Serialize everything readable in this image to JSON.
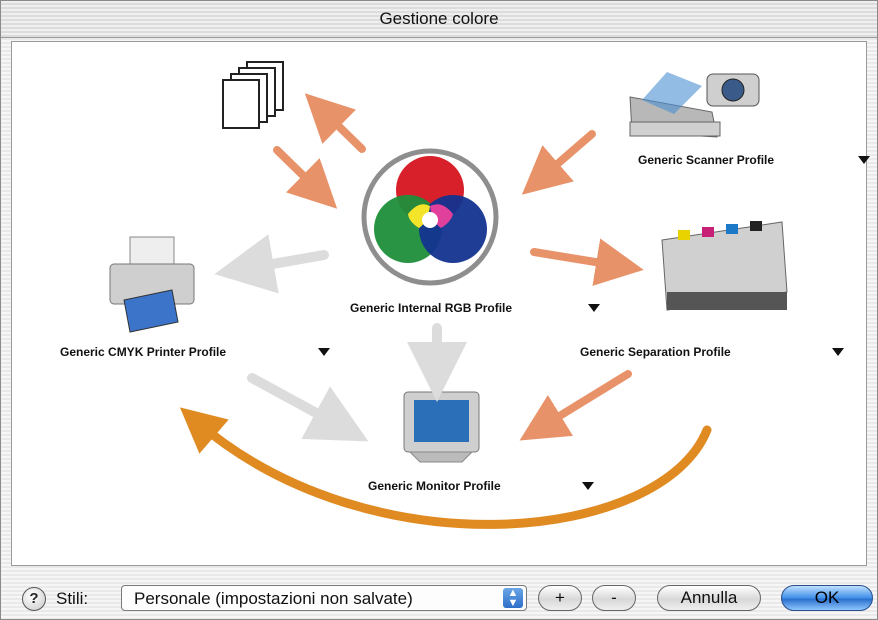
{
  "window": {
    "title": "Gestione colore"
  },
  "profiles": {
    "scanner": "Generic Scanner Profile",
    "internal_rgb": "Generic Internal RGB Profile",
    "separation": "Generic Separation Profile",
    "cmyk_printer": "Generic CMYK Printer Profile",
    "monitor": "Generic Monitor Profile"
  },
  "bottom": {
    "help": "?",
    "styles_label": "Stili:",
    "styles_value": "Personale (impostazioni non salvate)",
    "plus": "+",
    "minus": "-",
    "cancel": "Annulla",
    "ok": "OK"
  },
  "colors": {
    "arrow_orange": "#e8926a",
    "arrow_gray": "#dcdcdc",
    "loop_orange": "#e08a22",
    "accent_blue": "#2a6fcc"
  }
}
